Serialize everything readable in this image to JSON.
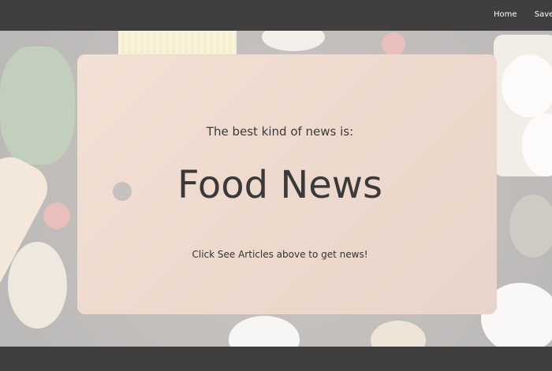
{
  "navbar": {
    "links": [
      "Home",
      "Saved Articles"
    ]
  },
  "hero": {
    "subtitle": "The best kind of news is:",
    "title": "Food News",
    "hint": "Click See Articles above to get news!"
  },
  "colors": {
    "navbar": "#3f3f3f",
    "footer": "#3e3e3e",
    "text": "#3a3a3a"
  }
}
